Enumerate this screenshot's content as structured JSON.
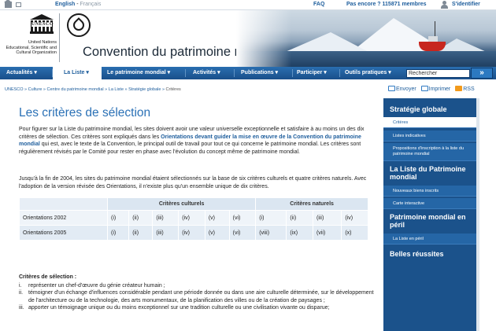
{
  "topbar": {
    "lang_en": "English",
    "lang_sep": " - ",
    "lang_fr": "Français",
    "faq": "FAQ",
    "members": "Pas encore ? 115871 membres",
    "login": "S'identifier"
  },
  "banner": {
    "unesco": "UNESCO",
    "org_line1": "United Nations",
    "org_line2": "Educational, Scientific and",
    "org_line3": "Cultural Organization",
    "site_title": "Convention du patrimoine mondial"
  },
  "nav": {
    "items": [
      "Actualités ▾",
      "La Liste ▾",
      "Le patrimoine mondial ▾",
      "Activités ▾",
      "Publications ▾",
      "Participer ▾",
      "Outils pratiques ▾"
    ],
    "search_value": "Rechercher",
    "go_label": "»"
  },
  "breadcrumb": {
    "path": "UNESCO » Culture » Centre du patrimoine mondial » La Liste » Stratégie globale » ",
    "current": "Critères"
  },
  "tools": {
    "send": "Envoyer",
    "print": "Imprimer",
    "rss": "RSS"
  },
  "page": {
    "title": "Les critères de sélection",
    "intro_a": "Pour figurer sur la Liste du patrimoine mondial, les sites doivent avoir une valeur universelle exceptionnelle et satisfaire à au moins un des dix critères de sélection. Ces critères sont expliqués dans les ",
    "intro_link": "Orientations devant guider la mise en œuvre de la Convention du patrimoine mondial",
    "intro_b": " qui est, avec le texte de la Convention, le principal outil de travail pour tout ce qui concerne le patrimoine mondial. Les critères sont régulièrement révisés par le Comité pour rester en phase avec l'évolution du concept même de patrimoine mondial.",
    "para2": "Jusqu'à la fin de 2004, les sites du patrimoine mondial étaient sélectionnés sur la base de six critères culturels et quatre critères naturels. Avec l'adoption de la version révisée des Orientations, il n'existe plus qu'un ensemble unique de dix critères."
  },
  "table": {
    "header_cultural": "Critères culturels",
    "header_natural": "Critères naturels",
    "rows": [
      {
        "label": "Orientations 2002",
        "cells": [
          "(i)",
          "(ii)",
          "(iii)",
          "(iv)",
          "(v)",
          "(vi)",
          "(i)",
          "(ii)",
          "(iii)",
          "(iv)"
        ]
      },
      {
        "label": "Orientations 2005",
        "cells": [
          "(i)",
          "(ii)",
          "(iii)",
          "(iv)",
          "(v)",
          "(vi)",
          "(viii)",
          "(ix)",
          "(vii)",
          "(x)"
        ]
      }
    ]
  },
  "criteria": {
    "heading": "Critères de sélection :",
    "items": [
      {
        "num": "i.",
        "text": "représenter un chef-d'œuvre du génie créateur humain ;"
      },
      {
        "num": "ii.",
        "text": "témoigner d'un échange d'influences considérable pendant une période donnée ou dans une aire culturelle déterminée, sur le développement de l'architecture ou de la technologie, des arts monumentaux, de la planification des villes ou de la création de paysages ;"
      },
      {
        "num": "iii.",
        "text": "apporter un témoignage unique ou du moins exceptionnel sur une tradition culturelle ou une civilisation vivante ou disparue;"
      }
    ]
  },
  "sidebar": {
    "section1": "Stratégie globale",
    "s1_items": [
      "Critères",
      "Listes indicatives",
      "Propositions d'inscription à la liste du patrimoine mondial"
    ],
    "section2": "La Liste du Patrimoine mondial",
    "s2_items": [
      "Nouveaux biens inscrits",
      "Carte interactive"
    ],
    "section3": "Patrimoine mondial en péril",
    "s3_items": [
      "La Liste en péril"
    ],
    "section4": "Belles réussites"
  },
  "colors": {
    "nav_blue": "#1a4f8a",
    "link_blue": "#1d5d9c",
    "sidebar_blue": "#1b528b",
    "title_blue": "#2b71b6"
  }
}
